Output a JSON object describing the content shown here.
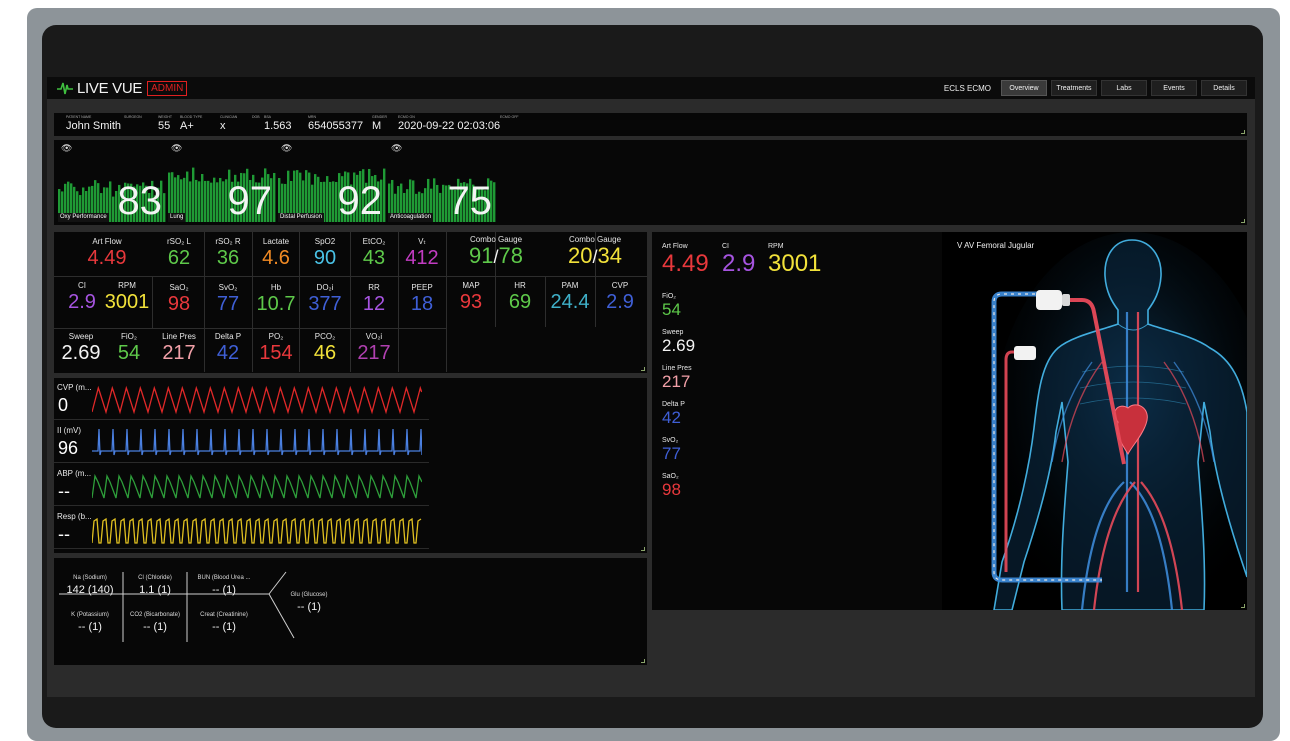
{
  "header": {
    "app_name": "LIVE VUE",
    "role_badge": "ADMIN",
    "mode_label": "ECLS ECMO",
    "tabs": [
      {
        "label": "Overview",
        "active": true
      },
      {
        "label": "Treatments",
        "active": false
      },
      {
        "label": "Labs",
        "active": false
      },
      {
        "label": "Events",
        "active": false
      },
      {
        "label": "Details",
        "active": false
      }
    ]
  },
  "patient": {
    "name_label": "PATIENT NAME",
    "name": "John Smith",
    "surgeon_label": "SURGEON",
    "surgeon": "",
    "weight_label": "WEIGHT",
    "weight": "55",
    "blood_type_label": "BLOOD TYPE",
    "blood_type": "A+",
    "clinician_label": "CLINICIAN",
    "clinician": "x",
    "dob_label": "DOB",
    "dob": "",
    "bsa_label": "BSA",
    "bsa": "1.563",
    "mrn_label": "MRN",
    "mrn": "654055377",
    "gender_label": "GENDER",
    "gender": "M",
    "ecmo_on_label": "ECMO ON",
    "ecmo_on": "2020-09-22 02:03:06",
    "ecmo_off_label": "ECMO OFF",
    "ecmo_off": ""
  },
  "gauges": [
    {
      "label": "Oxy Performance",
      "value": "83",
      "level": 0.55
    },
    {
      "label": "Lung",
      "value": "97",
      "level": 0.85
    },
    {
      "label": "Distal Perfusion",
      "value": "92",
      "level": 0.8
    },
    {
      "label": "Anticoagulation",
      "value": "75",
      "level": 0.6
    }
  ],
  "vitals": {
    "art_flow": {
      "label": "Art Flow",
      "value": "4.49"
    },
    "rso2_l": {
      "label": "rSO₂ L",
      "value": "62"
    },
    "rso2_r": {
      "label": "rSO₂ R",
      "value": "36"
    },
    "lactate": {
      "label": "Lactate",
      "value": "4.6"
    },
    "spo2": {
      "label": "SpO2",
      "value": "90"
    },
    "etco2": {
      "label": "EtCO₂",
      "value": "43"
    },
    "vt": {
      "label": "Vₜ",
      "value": "412"
    },
    "combo1": {
      "label": "Combo Gauge",
      "value_a": "91",
      "sep": "/",
      "value_b": "78"
    },
    "combo2": {
      "label": "Combo Gauge",
      "value_a": "20",
      "sep": "/",
      "value_b": "34"
    },
    "ci": {
      "label": "CI",
      "value": "2.9"
    },
    "rpm": {
      "label": "RPM",
      "value": "3001"
    },
    "sao2": {
      "label": "SaO₂",
      "value": "98"
    },
    "svo2": {
      "label": "SvO₂",
      "value": "77"
    },
    "hb": {
      "label": "Hb",
      "value": "10.7"
    },
    "do2i": {
      "label": "DO₂i",
      "value": "377"
    },
    "rr": {
      "label": "RR",
      "value": "12"
    },
    "peep": {
      "label": "PEEP",
      "value": "18"
    },
    "map": {
      "label": "MAP",
      "value": "93"
    },
    "hr": {
      "label": "HR",
      "value": "69"
    },
    "pam": {
      "label": "PAM",
      "value": "24.4"
    },
    "cvp": {
      "label": "CVP",
      "value": "2.9"
    },
    "sweep": {
      "label": "Sweep",
      "value": "2.69"
    },
    "fio2": {
      "label": "FiO₂",
      "value": "54"
    },
    "line_pres": {
      "label": "Line Pres",
      "value": "217"
    },
    "delta_p": {
      "label": "Delta P",
      "value": "42"
    },
    "po2": {
      "label": "PO₂",
      "value": "154"
    },
    "pco2": {
      "label": "PCO₂",
      "value": "46"
    },
    "vo2i": {
      "label": "VO₂i",
      "value": "217"
    }
  },
  "waveforms": [
    {
      "label": "CVP (m...",
      "value": "0",
      "color": "#e02828"
    },
    {
      "label": "II (mV)",
      "value": "96",
      "color": "#4a7fe0"
    },
    {
      "label": "ABP (m...",
      "value": "--",
      "color": "#2e9e3a"
    },
    {
      "label": "Resp (b...",
      "value": "--",
      "color": "#e0c020"
    }
  ],
  "labs": {
    "na": {
      "label": "Na (Sodium)",
      "value": "142 (140)"
    },
    "cl": {
      "label": "Cl (Chloride)",
      "value": "1.1 (1)"
    },
    "bun": {
      "label": "BUN (Blood Urea ...",
      "value": "-- (1)"
    },
    "k": {
      "label": "K (Potassium)",
      "value": "-- (1)"
    },
    "co2": {
      "label": "CO2 (Bicarbonate)",
      "value": "-- (1)"
    },
    "creat": {
      "label": "Creat (Creatinine)",
      "value": "-- (1)"
    },
    "glu": {
      "label": "Glu (Glucose)",
      "value": "-- (1)"
    }
  },
  "circuit": {
    "config_title": "V AV Femoral Jugular",
    "art_flow": {
      "label": "Art Flow",
      "value": "4.49"
    },
    "ci": {
      "label": "CI",
      "value": "2.9"
    },
    "rpm": {
      "label": "RPM",
      "value": "3001"
    },
    "fio2": {
      "label": "FiO₂",
      "value": "54"
    },
    "sweep": {
      "label": "Sweep",
      "value": "2.69"
    },
    "line_pres": {
      "label": "Line Pres",
      "value": "217"
    },
    "delta_p": {
      "label": "Delta P",
      "value": "42"
    },
    "svo2": {
      "label": "SvO₂",
      "value": "77"
    },
    "sao2": {
      "label": "SaO₂",
      "value": "98"
    }
  },
  "colors": {
    "red": "#e8383c",
    "green": "#5ec94a",
    "cyan": "#4ac2e6",
    "orange": "#f08a24",
    "yellow": "#f2e23a",
    "purple": "#a654e0",
    "magenta": "#c23cc2",
    "blue": "#3f5fd6",
    "pink": "#f2a0a8",
    "teal": "#3fb0c8",
    "white": "#f4f4f4"
  }
}
